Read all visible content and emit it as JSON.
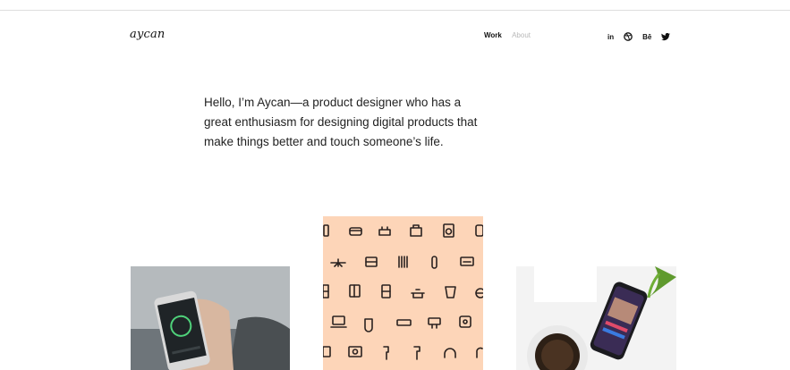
{
  "brand": {
    "logo": "aycan"
  },
  "nav": {
    "work": "Work",
    "about": "About"
  },
  "social": {
    "linkedin": "in",
    "behance": "Bē"
  },
  "hero": {
    "text": "Hello, I’m Aycan—a product designer who has a great enthusiasm for designing digital products that make things better and touch someone’s life."
  },
  "colors": {
    "accent_peach": "#fdd5b8",
    "text_dark": "#111111",
    "nav_inactive": "#b8b8b8"
  }
}
